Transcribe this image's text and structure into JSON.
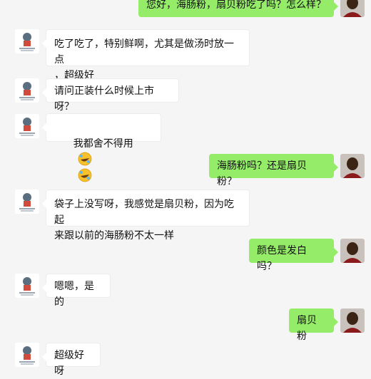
{
  "messages": [
    {
      "side": "right",
      "text": "您好，海肠粉，扇贝粉吃了吗？怎么样？"
    },
    {
      "side": "left",
      "text": "吃了吃了，特别鲜啊，尤其是做汤时放一点\n，超级好"
    },
    {
      "side": "left",
      "text": "请问正装什么时候上市呀？"
    },
    {
      "side": "left",
      "text": "我都舍不得用",
      "emoji": [
        "laughing-tears-emoji",
        "laughing-tears-emoji"
      ]
    },
    {
      "side": "right",
      "text": "海肠粉吗？还是扇贝粉？"
    },
    {
      "side": "left",
      "text": "袋子上没写呀，我感觉是扇贝粉，因为吃起\n来跟以前的海肠粉不太一样"
    },
    {
      "side": "right",
      "text": "颜色是发白吗？"
    },
    {
      "side": "left",
      "text": "嗯嗯，是的"
    },
    {
      "side": "right",
      "text": "扇贝粉"
    },
    {
      "side": "left",
      "text": "超级好呀"
    }
  ]
}
